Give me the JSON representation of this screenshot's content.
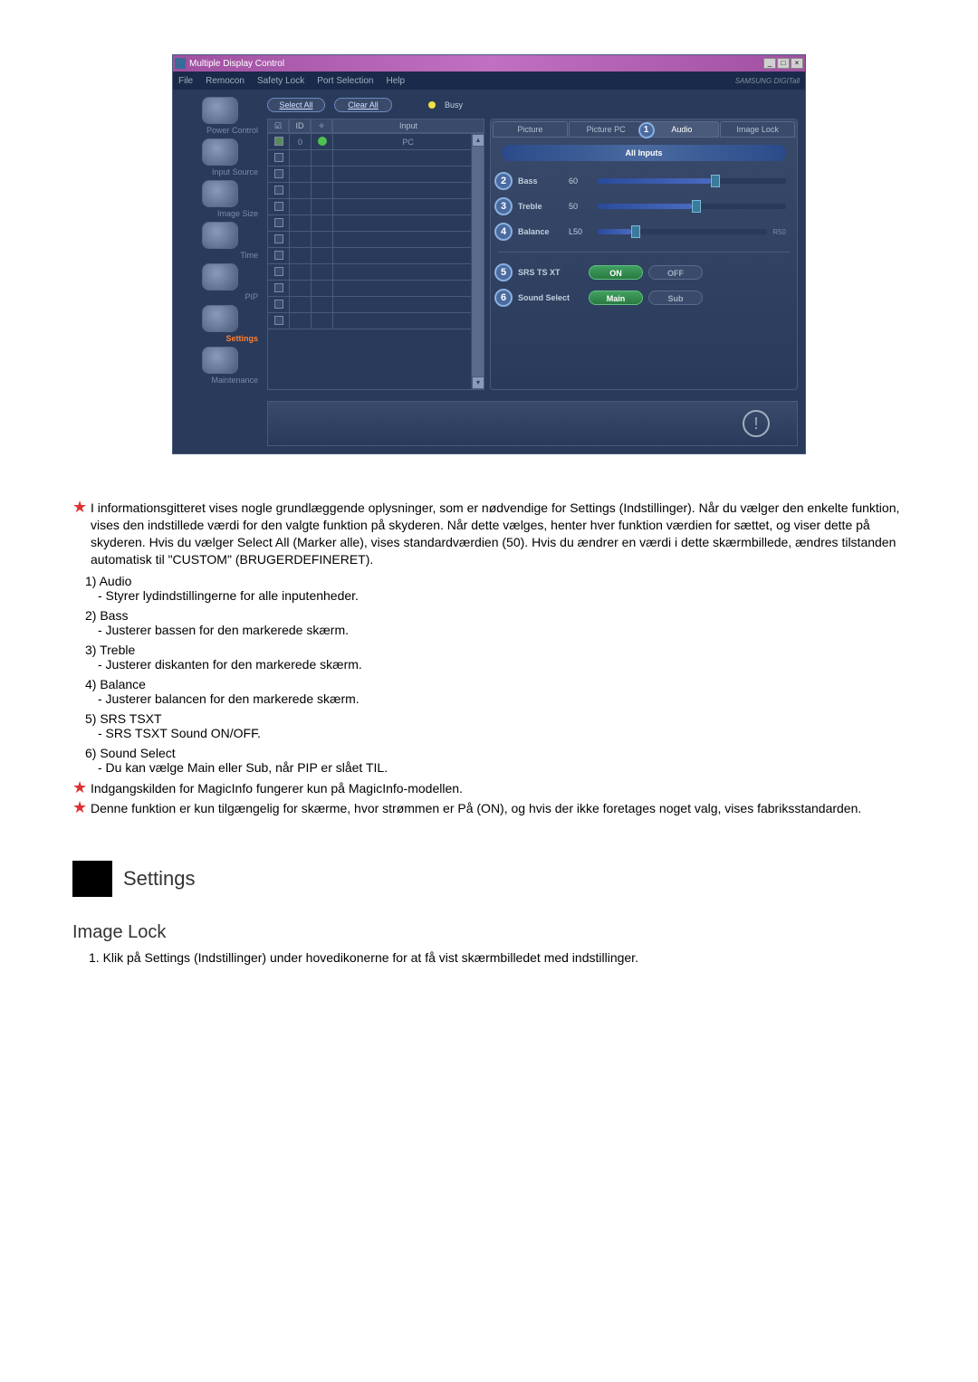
{
  "app": {
    "title": "Multiple Display Control"
  },
  "winControls": {
    "min": "_",
    "max": "□",
    "close": "×"
  },
  "menu": {
    "items": [
      "File",
      "Remocon",
      "Safety Lock",
      "Port Selection",
      "Help"
    ],
    "brand": "SAMSUNG DIGITall"
  },
  "sidebar": {
    "items": [
      {
        "label": "Power Control"
      },
      {
        "label": "Input Source"
      },
      {
        "label": "Image Size"
      },
      {
        "label": "Time"
      },
      {
        "label": "PIP"
      },
      {
        "label": "Settings",
        "active": true
      },
      {
        "label": "Maintenance"
      }
    ]
  },
  "actions": {
    "selectAll": "Select All",
    "clearAll": "Clear All",
    "busy": "Busy"
  },
  "grid": {
    "headers": {
      "chk": "☑",
      "id": "ID",
      "stat": "✧",
      "input": "Input"
    },
    "row0": {
      "id": "0",
      "input": "PC"
    }
  },
  "tabs": {
    "picture": "Picture",
    "picturePC": "Picture PC",
    "audio": "Audio",
    "audioNum": "1",
    "imageLock": "Image Lock"
  },
  "panel": {
    "allInputs": "All Inputs",
    "bassNum": "2",
    "bassLabel": "Bass",
    "bassVal": "60",
    "trebleNum": "3",
    "trebleLabel": "Treble",
    "trebleVal": "50",
    "balanceNum": "4",
    "balanceLabel": "Balance",
    "balanceValL": "L50",
    "balanceValR": "R50",
    "srsNum": "5",
    "srsLabel": "SRS TS XT",
    "srsOn": "ON",
    "srsOff": "OFF",
    "soundNum": "6",
    "soundLabel": "Sound Select",
    "soundMain": "Main",
    "soundSub": "Sub"
  },
  "doc": {
    "intro": "I informationsgitteret vises nogle grundlæggende oplysninger, som er nødvendige for Settings (Indstillinger). Når du vælger den enkelte funktion, vises den indstillede værdi for den valgte funktion på skyderen. Når dette vælges, henter hver funktion værdien for sættet, og viser dette på skyderen. Hvis du vælger Select All (Marker alle), vises standardværdien (50). Hvis du ændrer en værdi i dette skærmbillede, ændres tilstanden automatisk til \"CUSTOM\" (BRUGERDEFINERET).",
    "i1": "1)",
    "i1t": "Audio",
    "i1d": "- Styrer lydindstillingerne for alle inputenheder.",
    "i2": "2)",
    "i2t": "Bass",
    "i2d": "- Justerer bassen for den markerede skærm.",
    "i3": "3)",
    "i3t": "Treble",
    "i3d": "- Justerer diskanten for den markerede skærm.",
    "i4": "4)",
    "i4t": "Balance",
    "i4d": "- Justerer balancen for den markerede skærm.",
    "i5": "5)",
    "i5t": "SRS TSXT",
    "i5d": "- SRS TSXT Sound ON/OFF.",
    "i6": "6)",
    "i6t": "Sound Select",
    "i6d": "- Du kan vælge Main eller Sub, når PIP er slået TIL.",
    "note1": "Indgangskilden for MagicInfo fungerer kun på MagicInfo-modellen.",
    "note2": "Denne funktion er kun tilgængelig for skærme, hvor strømmen er På (ON), og hvis der ikke foretages noget valg, vises fabriksstandarden.",
    "sectionTitle": "Settings",
    "subTitle": "Image Lock",
    "step1": "1.  Klik på Settings (Indstillinger) under hovedikonerne for at få vist skærmbilledet med indstillinger."
  }
}
